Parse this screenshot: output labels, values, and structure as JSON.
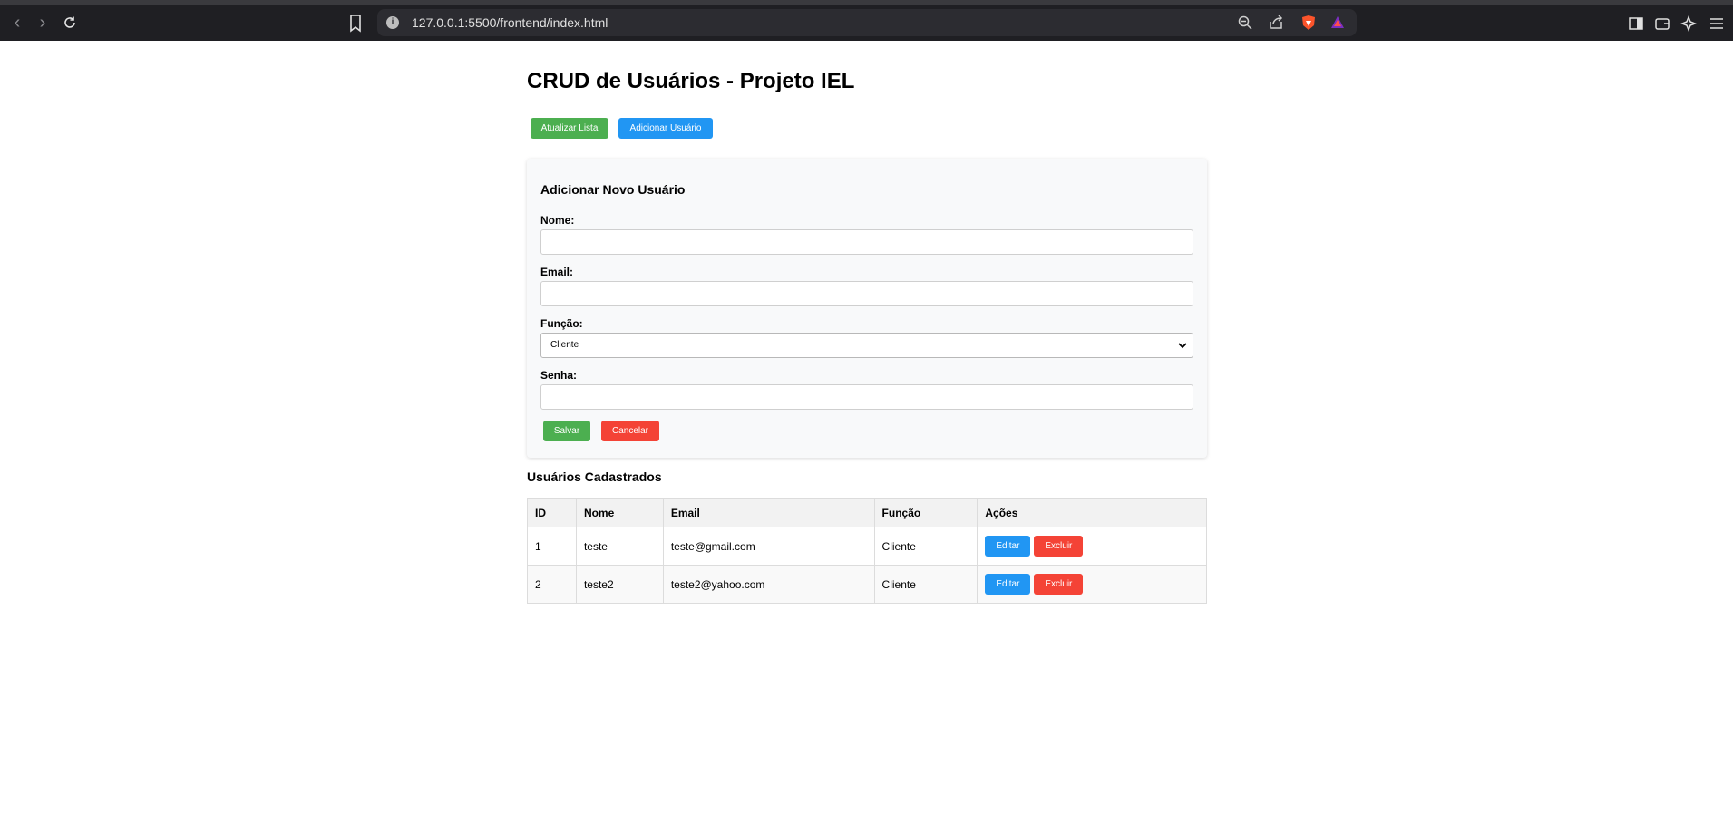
{
  "browser": {
    "url": "127.0.0.1:5500/frontend/index.html"
  },
  "page": {
    "title": "CRUD de Usuários - Projeto IEL",
    "toolbar": {
      "refresh_label": "Atualizar Lista",
      "add_label": "Adicionar Usuário"
    },
    "form": {
      "heading": "Adicionar Novo Usuário",
      "name_label": "Nome:",
      "name_value": "",
      "email_label": "Email:",
      "email_value": "",
      "role_label": "Função:",
      "role_selected": "Cliente",
      "password_label": "Senha:",
      "password_value": "",
      "save_label": "Salvar",
      "cancel_label": "Cancelar"
    },
    "list": {
      "heading": "Usuários Cadastrados",
      "columns": [
        "ID",
        "Nome",
        "Email",
        "Função",
        "Ações"
      ],
      "rows": [
        {
          "id": "1",
          "name": "teste",
          "email": "teste@gmail.com",
          "role": "Cliente",
          "edit": "Editar",
          "delete": "Excluir"
        },
        {
          "id": "2",
          "name": "teste2",
          "email": "teste2@yahoo.com",
          "role": "Cliente",
          "edit": "Editar",
          "delete": "Excluir"
        }
      ]
    }
  },
  "colors": {
    "green": "#4caf50",
    "blue": "#2196f3",
    "red": "#f44336"
  }
}
